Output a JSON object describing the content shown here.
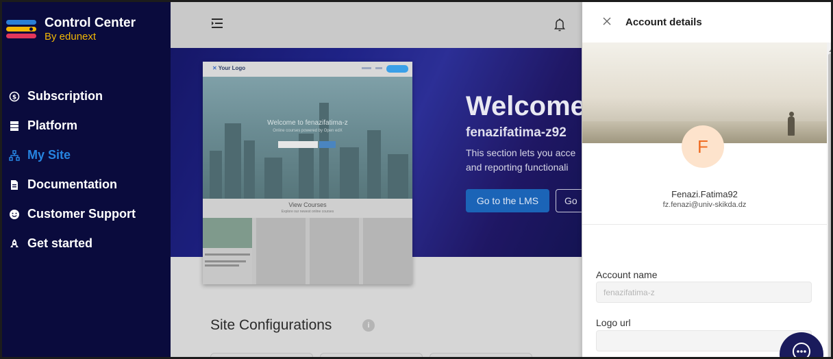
{
  "sidebar": {
    "brand_title": "Control Center",
    "brand_subtitle": "By edunext",
    "items": [
      {
        "label": "Subscription",
        "icon": "dollar-circle-icon",
        "active": false
      },
      {
        "label": "Platform",
        "icon": "server-icon",
        "active": false
      },
      {
        "label": "My Site",
        "icon": "sitemap-icon",
        "active": true
      },
      {
        "label": "Documentation",
        "icon": "document-icon",
        "active": false
      },
      {
        "label": "Customer Support",
        "icon": "smile-icon",
        "active": false
      },
      {
        "label": "Get started",
        "icon": "rocket-icon",
        "active": false
      }
    ]
  },
  "topbar": {
    "menu_icon": "menu-collapse-icon",
    "bell_icon": "bell-icon"
  },
  "hero": {
    "title": "Welcome",
    "subtitle": "fenazifatima-z92",
    "desc_line1": "This section lets you acce",
    "desc_line2": "and reporting functionali",
    "btn_lms": "Go to the LMS",
    "btn_second": "Go"
  },
  "preview": {
    "logo": "Your Logo",
    "welcome": "Welcome to fenazifatima-z",
    "welcome_sub": "Online courses powered by Open edX",
    "courses_title": "View Courses",
    "courses_sub": "Explore our newest online courses"
  },
  "site_config": {
    "title": "Site Configurations",
    "info": "i"
  },
  "drawer": {
    "title": "Account details",
    "avatar_letter": "F",
    "name": "Fenazi.Fatima92",
    "email": "fz.fenazi@univ-skikda.dz",
    "account_name_label": "Account name",
    "account_name_value": "fenazifatima-z",
    "logo_url_label": "Logo url",
    "logo_url_value": ""
  },
  "colors": {
    "sidebar_bg": "#0a0b3d",
    "active_nav": "#2684e0",
    "brand_yellow": "#f2b705",
    "primary_button": "#1b64b7",
    "avatar_bg": "#fde3cc",
    "avatar_text": "#ef6c22",
    "chat_button": "#1a1b5c"
  }
}
